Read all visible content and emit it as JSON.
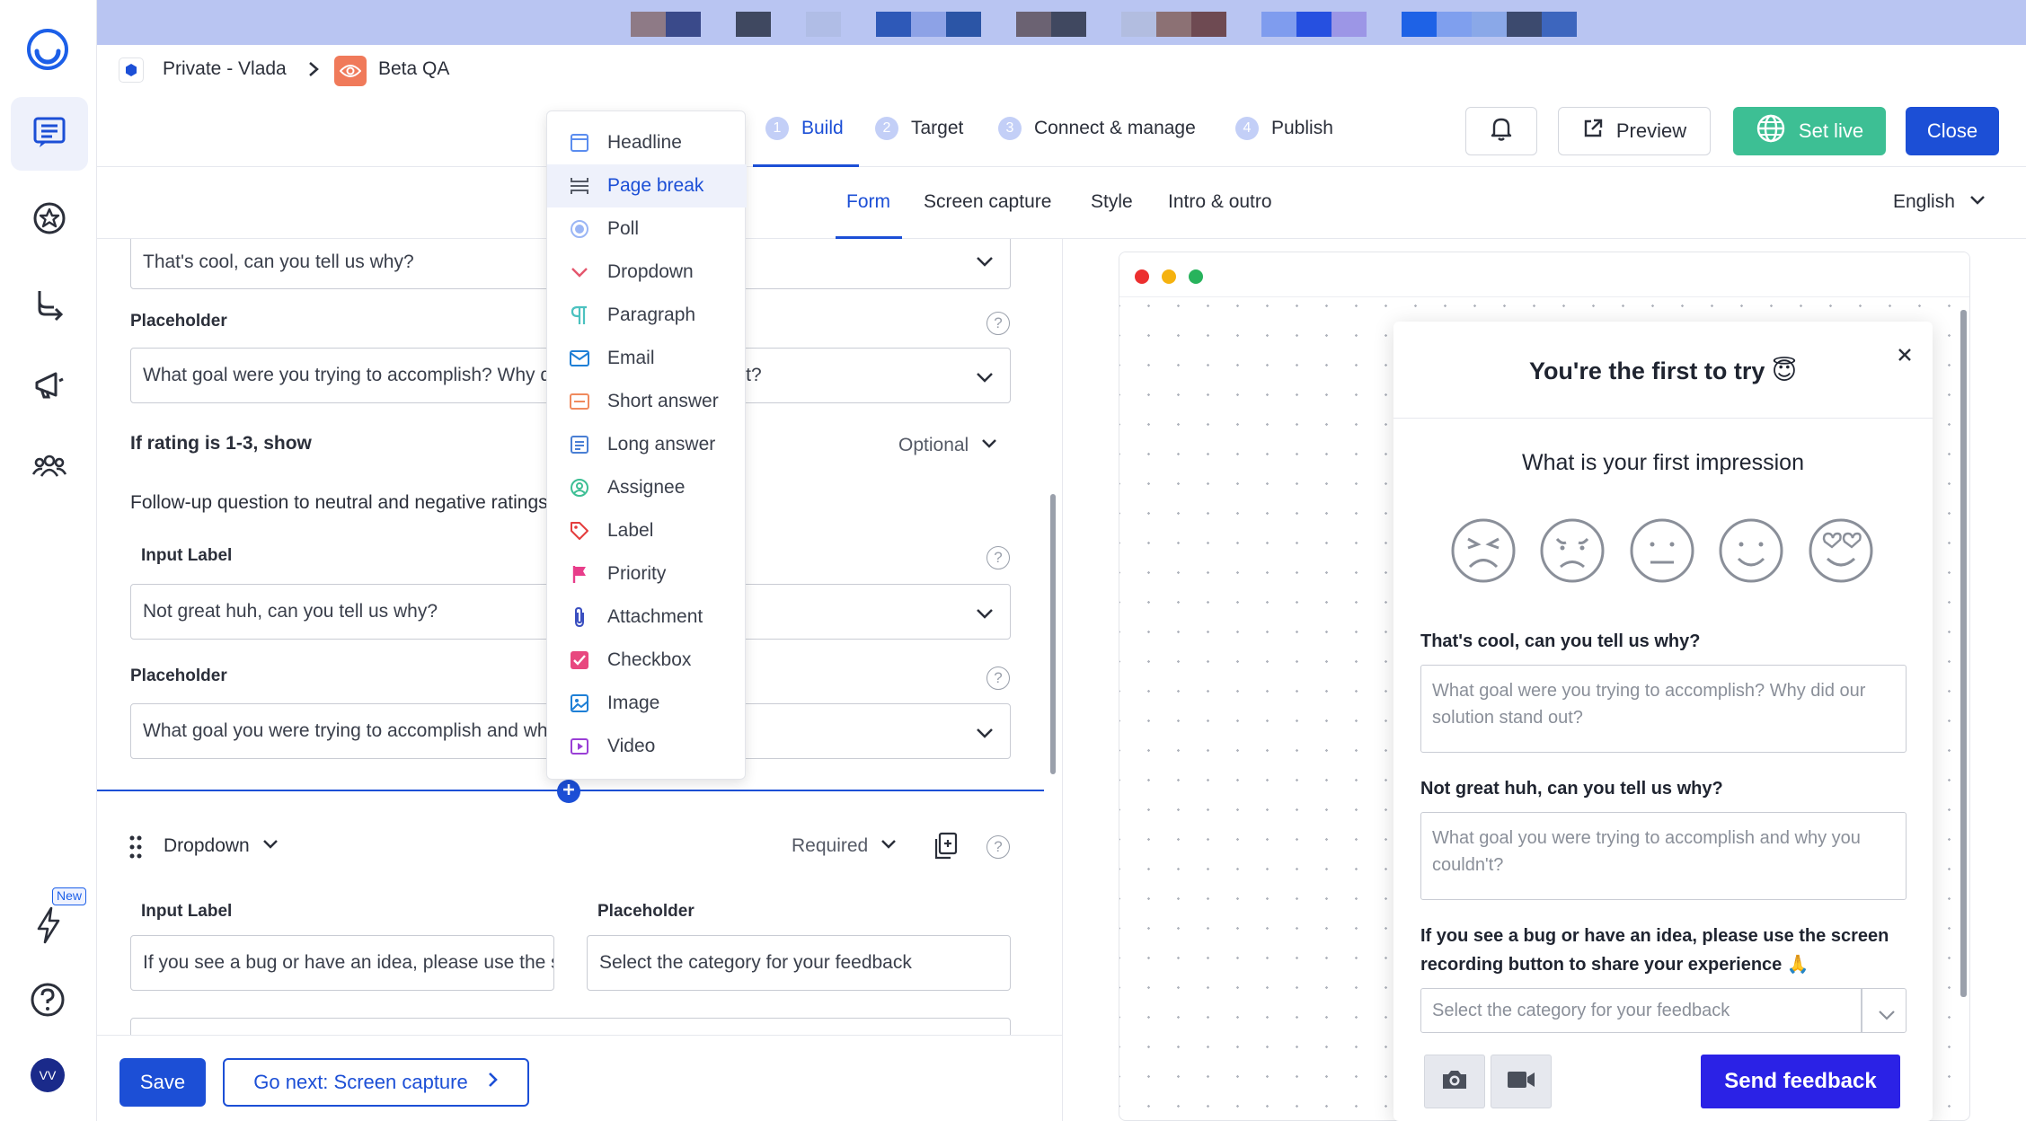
{
  "breadcrumb": {
    "workspace": "Private - Vlada",
    "project": "Beta QA"
  },
  "steps": [
    {
      "num": "1",
      "label": "Build"
    },
    {
      "num": "2",
      "label": "Target"
    },
    {
      "num": "3",
      "label": "Connect & manage"
    },
    {
      "num": "4",
      "label": "Publish"
    }
  ],
  "toolbar": {
    "preview": "Preview",
    "set_live": "Set live",
    "close": "Close"
  },
  "subtabs": [
    "Form",
    "Screen capture",
    "Style",
    "Intro & outro"
  ],
  "language": "English",
  "form": {
    "field1_value": "That's cool, can you tell us why?",
    "placeholder_label": "Placeholder",
    "field2_value": "What goal were you trying to accomplish? Why did our solution stand out?",
    "condition": "If rating is 1-3, show",
    "optional": "Optional",
    "followup": "Follow-up question to neutral and negative ratings",
    "input_label": "Input Label",
    "field3_value": "Not great huh, can you tell us why?",
    "placeholder_label2": "Placeholder",
    "field4_value": "What goal you were trying to accomplish and why you couldn't?",
    "dropdown_block": {
      "type": "Dropdown",
      "required": "Required",
      "input_label": "Input Label",
      "placeholder_label": "Placeholder",
      "input_value": "If you see a bug or have an idea, please use the screen recording button",
      "placeholder_value": "Select the category for your feedback"
    }
  },
  "menu_items": [
    {
      "label": "Headline",
      "icon": "headline-icon"
    },
    {
      "label": "Page break",
      "icon": "page-break-icon"
    },
    {
      "label": "Poll",
      "icon": "poll-icon"
    },
    {
      "label": "Dropdown",
      "icon": "dropdown-icon"
    },
    {
      "label": "Paragraph",
      "icon": "paragraph-icon"
    },
    {
      "label": "Email",
      "icon": "email-icon"
    },
    {
      "label": "Short answer",
      "icon": "short-answer-icon"
    },
    {
      "label": "Long answer",
      "icon": "long-answer-icon"
    },
    {
      "label": "Assignee",
      "icon": "assignee-icon"
    },
    {
      "label": "Label",
      "icon": "label-icon"
    },
    {
      "label": "Priority",
      "icon": "priority-icon"
    },
    {
      "label": "Attachment",
      "icon": "attachment-icon"
    },
    {
      "label": "Checkbox",
      "icon": "checkbox-icon"
    },
    {
      "label": "Image",
      "icon": "image-icon"
    },
    {
      "label": "Video",
      "icon": "video-icon"
    }
  ],
  "menu_selected": "Page break",
  "footer": {
    "save": "Save",
    "next": "Go next: Screen capture"
  },
  "sidebar_badge": "New",
  "avatar_initials": "VV",
  "preview": {
    "title": "You're the first to try 😇",
    "question": "What is your first impression",
    "q1_label": "That's cool, can you tell us why?",
    "q1_placeholder": "What goal were you trying to accomplish? Why did our solution stand out?",
    "q2_label": "Not great huh, can you tell us why?",
    "q2_placeholder": "What goal you were trying to accomplish and why you couldn't?",
    "q3_label": "If you see a bug or have an idea, please use the screen recording button to share your experience 🙏",
    "q3_placeholder": "Select the category for your feedback",
    "send": "Send feedback"
  },
  "colors": {
    "accent": "#1c4fd6",
    "set_live": "#3dbf94",
    "send": "#2b22e6"
  }
}
